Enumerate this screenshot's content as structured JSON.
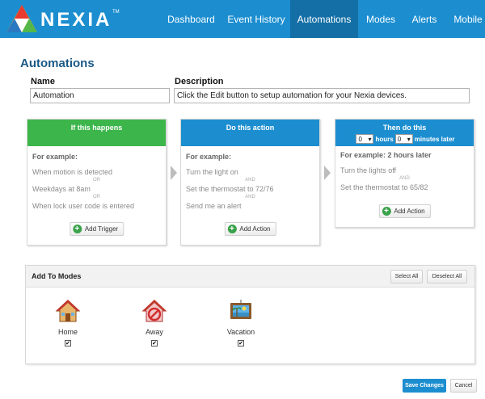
{
  "header": {
    "brand": "NEXIA",
    "tm": "TM",
    "nav": [
      {
        "label": "Dashboard"
      },
      {
        "label": "Event History"
      },
      {
        "label": "Automations"
      },
      {
        "label": "Modes"
      },
      {
        "label": "Alerts"
      },
      {
        "label": "Mobile"
      }
    ],
    "colors": {
      "bar": "#1c8ed0",
      "active": "#136fa6"
    }
  },
  "page": {
    "title": "Automations",
    "name_label": "Name",
    "name_value": "Automation",
    "description_label": "Description",
    "description_value": "Click the Edit button to setup automation for your Nexia devices."
  },
  "cards": {
    "trigger": {
      "title": "If this happens",
      "example_label": "For example:",
      "items": [
        "When motion is detected",
        "Weekdays at 8am",
        "When lock user code is entered"
      ],
      "connector": "OR",
      "button": "Add Trigger",
      "color": "#3cb54a"
    },
    "action": {
      "title": "Do this action",
      "example_label": "For example:",
      "items": [
        "Turn the light on",
        "Set the thermostat to 72/76",
        "Send me an alert"
      ],
      "connector": "AND",
      "button": "Add Action",
      "color": "#1c8ed0"
    },
    "delayed": {
      "title": "Then do this",
      "hours_value": "0",
      "hours_label": "hours",
      "minutes_value": "0",
      "minutes_label": "minutes later",
      "example_label": "For example: 2 hours later",
      "items": [
        "Turn the lights off",
        "Set the thermostat to 65/82"
      ],
      "connector": "AND",
      "button": "Add Action",
      "color": "#1c8ed0"
    }
  },
  "modes": {
    "title": "Add To Modes",
    "select_all": "Select All",
    "deselect_all": "Deselect All",
    "items": [
      {
        "label": "Home",
        "checked": true,
        "icon": "house-icon"
      },
      {
        "label": "Away",
        "checked": true,
        "icon": "away-house-icon"
      },
      {
        "label": "Vacation",
        "checked": true,
        "icon": "vacation-picture-icon"
      }
    ],
    "check_mark": "✔"
  },
  "footer": {
    "save": "Save Changes",
    "cancel": "Cancel",
    "save_color": "#1c8ed0"
  }
}
